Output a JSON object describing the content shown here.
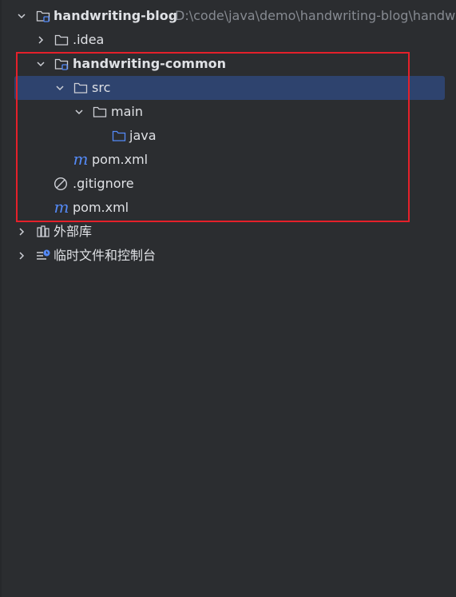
{
  "project_tree": {
    "root": {
      "label": "handwriting-blog",
      "path": "D:\\code\\java\\demo\\handwriting-blog\\handwr"
    },
    "items": [
      {
        "label": ".idea"
      },
      {
        "label": "handwriting-common"
      },
      {
        "label": "src"
      },
      {
        "label": "main"
      },
      {
        "label": "java"
      },
      {
        "label": "pom.xml"
      },
      {
        "label": ".gitignore"
      },
      {
        "label": "pom.xml"
      },
      {
        "label": "外部库"
      },
      {
        "label": "临时文件和控制台"
      }
    ]
  },
  "icons": {
    "maven_glyph": "m"
  },
  "colors": {
    "background": "#2b2d30",
    "selection": "#2e436e",
    "text": "#dfe1e5",
    "path_text": "#868a91",
    "source_folder": "#548af7",
    "annotation": "#e5202a"
  }
}
